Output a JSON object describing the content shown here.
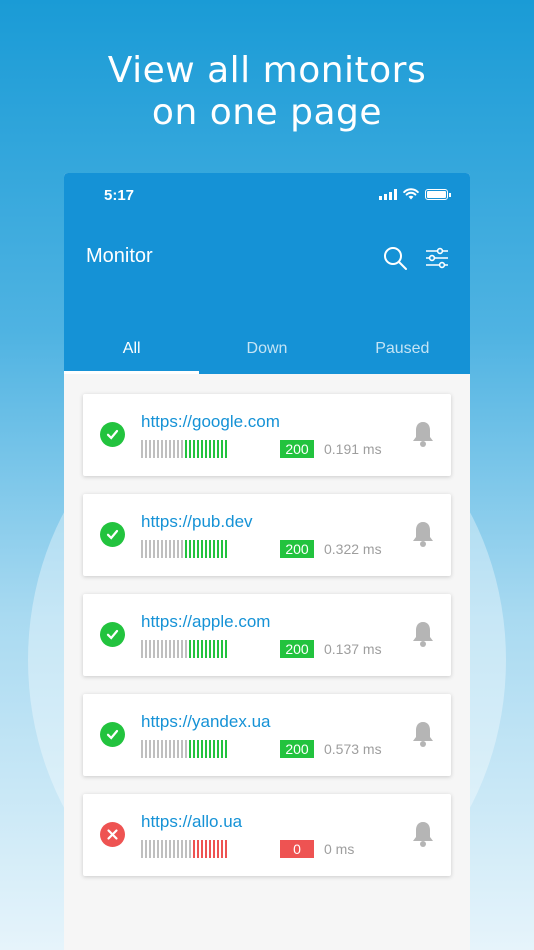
{
  "headline": {
    "line1": "View all monitors",
    "line2": "on one page"
  },
  "status_bar": {
    "time": "5:17"
  },
  "app": {
    "title": "Monitor"
  },
  "tabs": [
    {
      "label": "All",
      "active": true
    },
    {
      "label": "Down",
      "active": false
    },
    {
      "label": "Paused",
      "active": false
    }
  ],
  "monitors": [
    {
      "url": "https://google.com",
      "status": "up",
      "code": "200",
      "ms": "0.191 ms",
      "icon": "check-icon",
      "uptime_bars": {
        "total": 22,
        "gray": 11,
        "colored": 11
      }
    },
    {
      "url": "https://pub.dev",
      "status": "up",
      "code": "200",
      "ms": "0.322 ms",
      "icon": "check-icon",
      "uptime_bars": {
        "total": 22,
        "gray": 11,
        "colored": 11
      }
    },
    {
      "url": "https://apple.com",
      "status": "up",
      "code": "200",
      "ms": "0.137 ms",
      "icon": "check-icon",
      "uptime_bars": {
        "total": 22,
        "gray": 12,
        "colored": 10
      }
    },
    {
      "url": "https://yandex.ua",
      "status": "up",
      "code": "200",
      "ms": "0.573 ms",
      "icon": "check-icon",
      "uptime_bars": {
        "total": 22,
        "gray": 12,
        "colored": 10
      }
    },
    {
      "url": "https://allo.ua",
      "status": "down",
      "code": "0",
      "ms": "0 ms",
      "icon": "cross-icon",
      "uptime_bars": {
        "total": 22,
        "gray": 13,
        "colored": 9
      }
    }
  ],
  "colors": {
    "accent": "#1592d6",
    "up": "#22c33e",
    "down": "#ee5352",
    "muted": "#bfbfbf"
  }
}
